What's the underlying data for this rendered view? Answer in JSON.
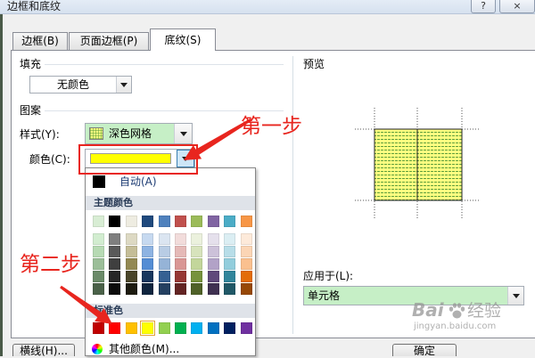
{
  "window": {
    "title": "边框和底纹",
    "help": "?",
    "close": "×"
  },
  "tabs": {
    "borders": "边框(B)",
    "page_border": "页面边框(P)",
    "shading": "底纹(S)",
    "active": "shading"
  },
  "fill": {
    "heading": "填充",
    "value": "无颜色"
  },
  "pattern": {
    "heading": "图案",
    "style_label": "样式(Y):",
    "style_value": "深色网格",
    "style_swatch_color": "#FFFF80",
    "color_label": "颜色(C):",
    "color_value": "#FFFF00"
  },
  "color_menu": {
    "auto_label": "自动(A)",
    "auto_color": "#000000",
    "theme_heading": "主题颜色",
    "theme_colors": [
      "#D8EDD4",
      "#000000",
      "#EEECE1",
      "#1F497D",
      "#4F81BD",
      "#C0504D",
      "#9BBB59",
      "#8064A2",
      "#4BACC6",
      "#F79646"
    ],
    "theme_shades": [
      [
        "#D2EDD0",
        "#7F7F7F",
        "#DDD9C3",
        "#C6D9F0",
        "#DBE5F1",
        "#F2DCDB",
        "#EBF1DD",
        "#E5E0EC",
        "#DBEEF3",
        "#FDEADA"
      ],
      [
        "#B6DAB3",
        "#595959",
        "#C4BD97",
        "#8DB3E2",
        "#B8CCE4",
        "#E5B9B7",
        "#D7E3BC",
        "#CCC1D9",
        "#B7DDE8",
        "#FBD5B5"
      ],
      [
        "#9BBE98",
        "#3F3F3F",
        "#938953",
        "#548DD4",
        "#95B3D7",
        "#D99694",
        "#C3D69B",
        "#B2A2C7",
        "#92CDDC",
        "#FAC08F"
      ],
      [
        "#6A8A68",
        "#262626",
        "#494429",
        "#17365D",
        "#366092",
        "#953734",
        "#76923C",
        "#5F497A",
        "#31859B",
        "#E36C09"
      ],
      [
        "#4A6148",
        "#0C0C0C",
        "#1D1B10",
        "#0F243E",
        "#244061",
        "#632423",
        "#4F6128",
        "#3F3151",
        "#205867",
        "#974806"
      ]
    ],
    "standard_heading": "标准色",
    "standard_colors": [
      "#C00000",
      "#FF0000",
      "#FFC000",
      "#FFFF00",
      "#92D050",
      "#00B050",
      "#00B0F0",
      "#0070C0",
      "#002060",
      "#7030A0"
    ],
    "selected_standard_index": 3,
    "more_colors_label": "其他颜色(M)..."
  },
  "preview": {
    "heading": "预览",
    "fill_color": "#FFFF80",
    "pattern_color": "#5E9E3E"
  },
  "apply_to": {
    "label": "应用于(L):",
    "value": "单元格"
  },
  "buttons": {
    "horizontal_line": "横线(H)...",
    "ok": "确定"
  },
  "annotations": {
    "step1": "第一步",
    "step2": "第二步",
    "color": "#E8251E"
  },
  "watermark": {
    "brand": "Bai",
    "brand_cn": "经验",
    "site": "jingyan.baidu.com"
  },
  "colors": {
    "highlight_green": "#C6EFC6",
    "arrow_button_blue": "#CDE6F7",
    "accent_blue": "#3C7FB1"
  }
}
